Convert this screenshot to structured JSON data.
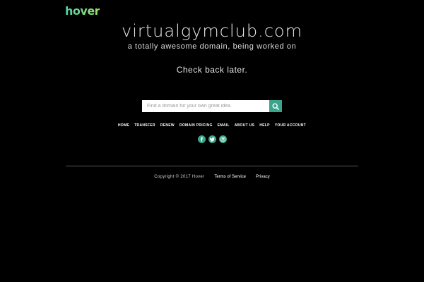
{
  "brand": {
    "logo_text": "hover"
  },
  "hero": {
    "domain": "virtualgymclub.com",
    "tagline": "a totally awesome domain, being worked on",
    "check_back": "Check back later."
  },
  "search": {
    "placeholder": "Find a domain for your own great idea."
  },
  "nav": {
    "items": [
      {
        "label": "Home"
      },
      {
        "label": "Transfer"
      },
      {
        "label": "Renew"
      },
      {
        "label": "Domain Pricing"
      },
      {
        "label": "Email"
      },
      {
        "label": "About Us"
      },
      {
        "label": "Help"
      },
      {
        "label": "Your Account"
      }
    ]
  },
  "social": {
    "icons": [
      "facebook-icon",
      "twitter-icon",
      "instagram-icon"
    ]
  },
  "footer": {
    "copyright": "Copyright © 2017 Hover",
    "terms": "Terms of Service",
    "privacy": "Privacy"
  },
  "colors": {
    "accent": "#3aa58a",
    "background": "#000000"
  }
}
